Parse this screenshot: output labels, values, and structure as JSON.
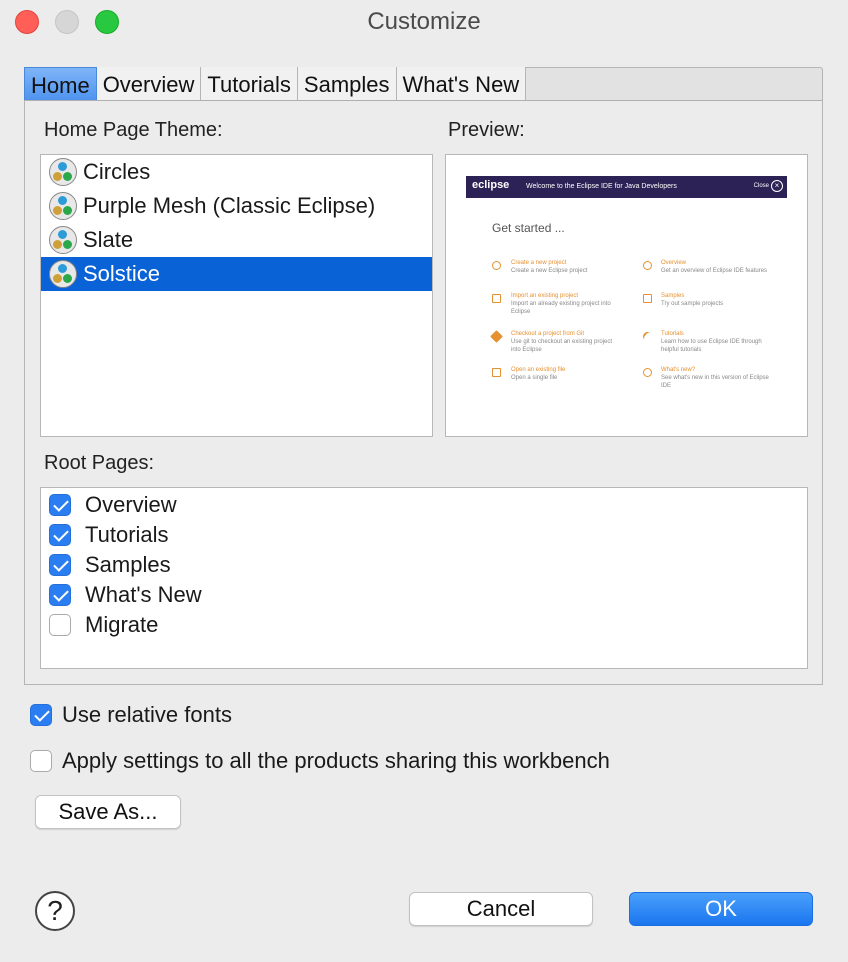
{
  "window": {
    "title": "Customize"
  },
  "tabs": [
    {
      "label": "Home",
      "active": true
    },
    {
      "label": "Overview",
      "active": false
    },
    {
      "label": "Tutorials",
      "active": false
    },
    {
      "label": "Samples",
      "active": false
    },
    {
      "label": "What's New",
      "active": false
    }
  ],
  "home": {
    "theme_label": "Home Page Theme:",
    "preview_label": "Preview:",
    "themes": [
      {
        "label": "Circles",
        "selected": false
      },
      {
        "label": "Purple Mesh (Classic Eclipse)",
        "selected": false
      },
      {
        "label": "Slate",
        "selected": false
      },
      {
        "label": "Solstice",
        "selected": true
      }
    ],
    "preview": {
      "logo": "eclipse",
      "heading": "Welcome to the Eclipse IDE for Java Developers",
      "close": "Close",
      "get_started": "Get started ...",
      "items": [
        {
          "title": "Create a new project",
          "desc": "Create a new Eclipse project"
        },
        {
          "title": "Overview",
          "desc": "Get an overview of Eclipse IDE features"
        },
        {
          "title": "Import an existing project",
          "desc": "Import an already existing project into Eclipse"
        },
        {
          "title": "Samples",
          "desc": "Try out sample projects"
        },
        {
          "title": "Checkout a project from Git",
          "desc": "Use git to checkout an existing project into Eclipse"
        },
        {
          "title": "Tutorials",
          "desc": "Learn how to use Eclipse IDE through helpful tutorials"
        },
        {
          "title": "Open an existing file",
          "desc": "Open a single file"
        },
        {
          "title": "What's new?",
          "desc": "See what's new in this version of Eclipse IDE"
        }
      ]
    },
    "root_label": "Root Pages:",
    "root_pages": [
      {
        "label": "Overview",
        "checked": true
      },
      {
        "label": "Tutorials",
        "checked": true
      },
      {
        "label": "Samples",
        "checked": true
      },
      {
        "label": "What's New",
        "checked": true
      },
      {
        "label": "Migrate",
        "checked": false
      }
    ]
  },
  "options": {
    "relative_fonts": {
      "label": "Use relative fonts",
      "checked": true
    },
    "apply_all": {
      "label": "Apply settings to all the products sharing this workbench",
      "checked": false
    }
  },
  "buttons": {
    "save_as": "Save As...",
    "cancel": "Cancel",
    "ok": "OK",
    "help": "?"
  },
  "colors": {
    "accent": "#2b7ef2",
    "selection": "#0a63d6",
    "preview_bar": "#2c2255",
    "preview_link": "#e69030"
  }
}
